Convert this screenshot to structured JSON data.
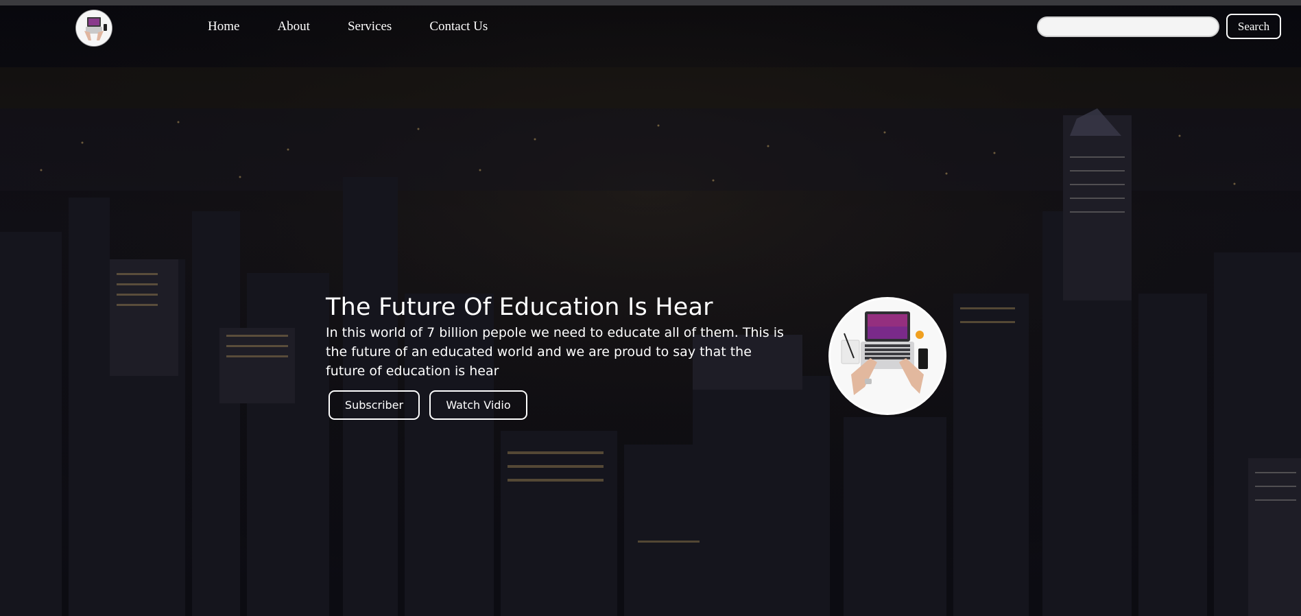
{
  "navbar": {
    "logo_icon": "laptop-workspace-icon",
    "links": [
      {
        "label": "Home"
      },
      {
        "label": "About"
      },
      {
        "label": "Services"
      },
      {
        "label": "Contact Us"
      }
    ],
    "search": {
      "placeholder": "",
      "value": "",
      "button_label": "Search"
    }
  },
  "hero": {
    "title": "The Future Of Education Is Hear",
    "text": "In this world of 7 billion pepole we need to educate all of them. This is the future of an educated world and we are proud to say that the future of education is hear",
    "buttons": {
      "subscribe_label": "Subscriber",
      "watch_label": "Watch Vidio"
    },
    "image_icon": "laptop-workspace-icon"
  },
  "colors": {
    "background": "#0b0b12",
    "text": "#ffffff",
    "accent": "#ffffff"
  }
}
